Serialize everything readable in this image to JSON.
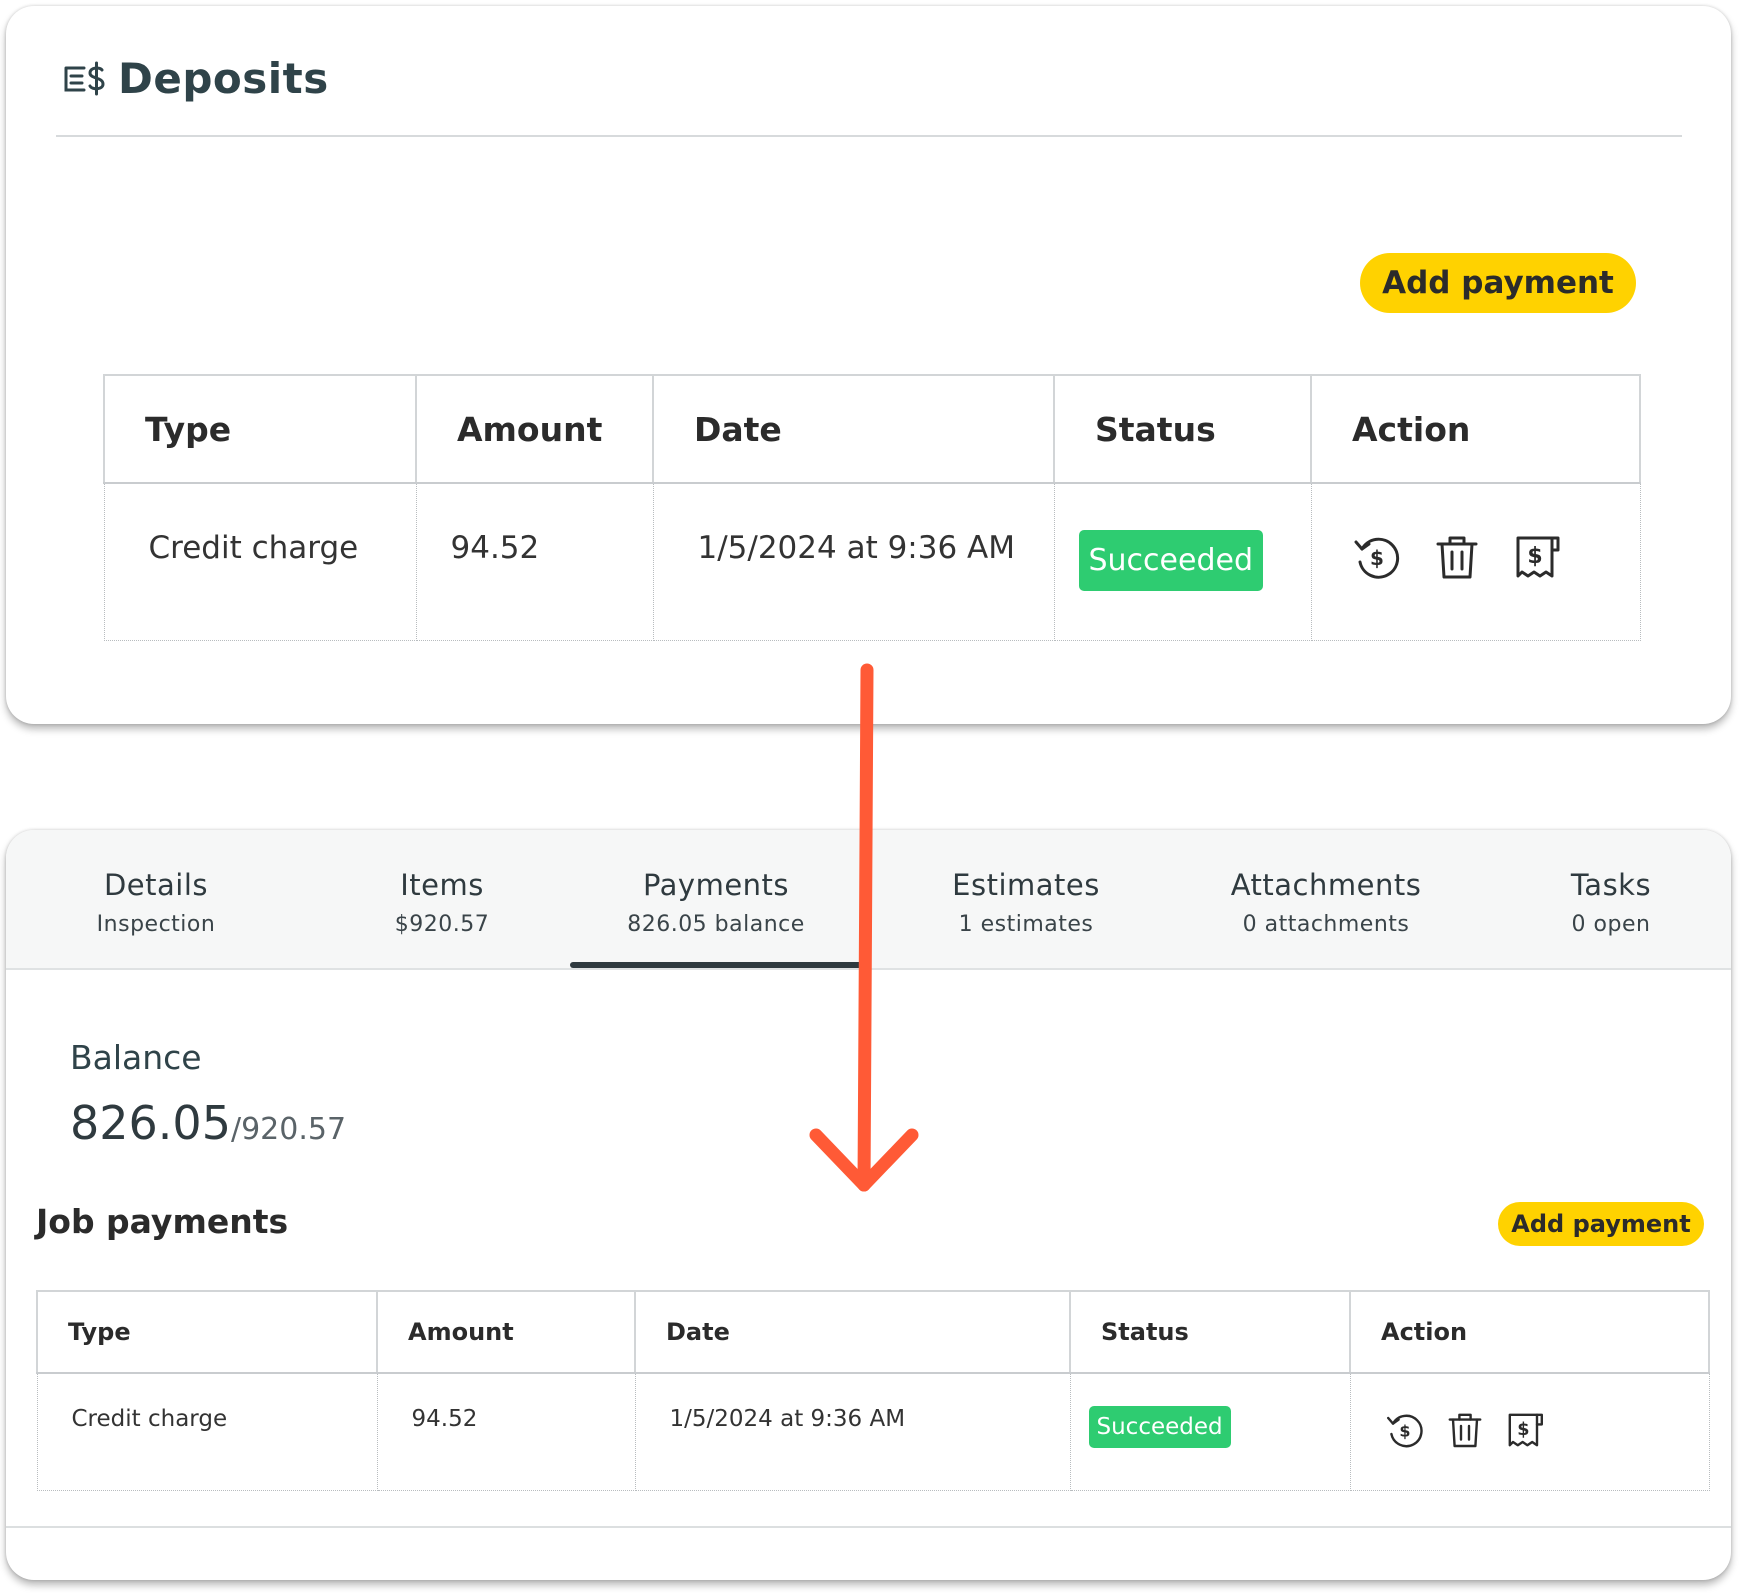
{
  "deposits": {
    "title": "Deposits",
    "icon": "deposit-money-icon",
    "add_payment_label": "Add payment",
    "table": {
      "headers": [
        "Type",
        "Amount",
        "Date",
        "Status",
        "Action"
      ],
      "rows": [
        {
          "type": "Credit charge",
          "amount": "94.52",
          "date": "1/5/2024 at 9:36 AM",
          "status": "Succeeded",
          "actions": [
            "refund-icon",
            "trash-icon",
            "receipt-icon"
          ]
        }
      ]
    }
  },
  "job": {
    "tabs": [
      {
        "label": "Details",
        "sub": "Inspection"
      },
      {
        "label": "Items",
        "sub": "$920.57"
      },
      {
        "label": "Payments",
        "sub": "826.05 balance",
        "active": true
      },
      {
        "label": "Estimates",
        "sub": "1 estimates"
      },
      {
        "label": "Attachments",
        "sub": "0 attachments"
      },
      {
        "label": "Tasks",
        "sub": "0 open"
      }
    ],
    "balance": {
      "label": "Balance",
      "amount": "826.05",
      "total": "/920.57"
    },
    "payments_title": "Job payments",
    "add_payment_label": "Add payment",
    "table": {
      "headers": [
        "Type",
        "Amount",
        "Date",
        "Status",
        "Action"
      ],
      "rows": [
        {
          "type": "Credit charge",
          "amount": "94.52",
          "date": "1/5/2024 at 9:36 AM",
          "status": "Succeeded",
          "actions": [
            "refund-icon",
            "trash-icon",
            "receipt-icon"
          ]
        }
      ]
    }
  },
  "colors": {
    "accent_yellow": "#ffd200",
    "status_green": "#2ecc71",
    "annotation_arrow": "#ff5a36",
    "heading_text": "#2f4349"
  }
}
